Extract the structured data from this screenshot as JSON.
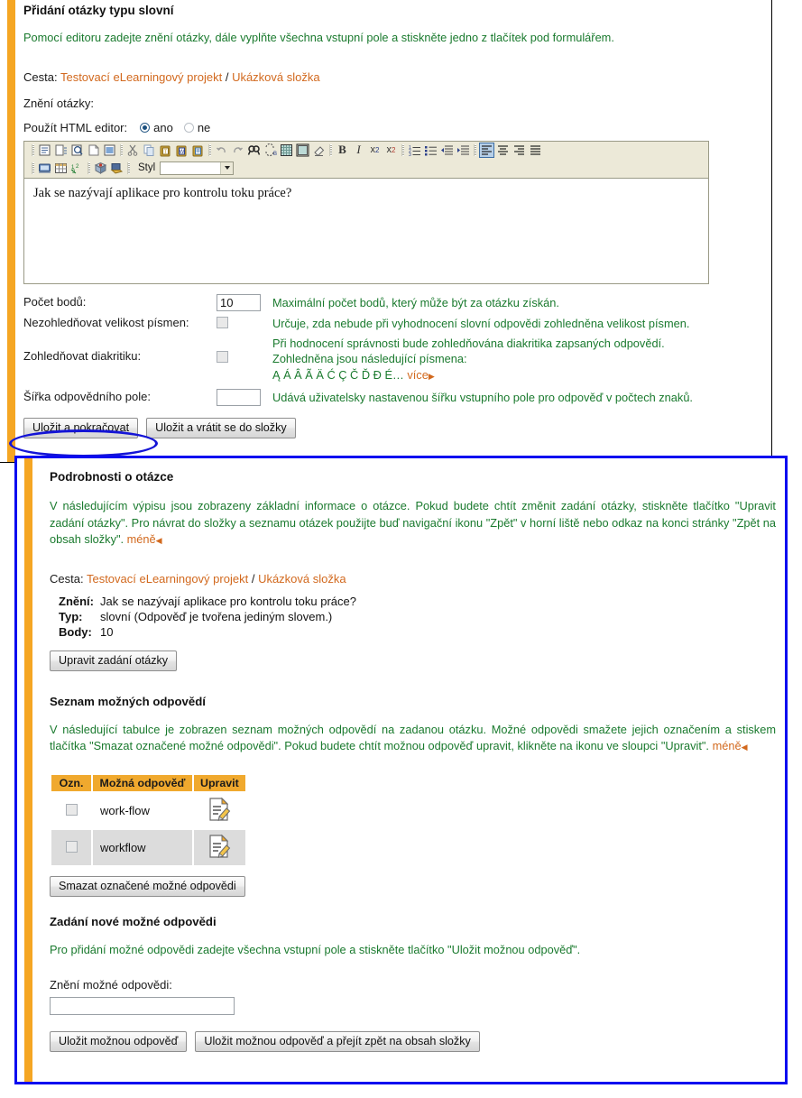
{
  "top": {
    "title": "Přidání otázky typu slovní",
    "intro": "Pomocí editoru zadejte znění otázky, dále vyplňte všechna vstupní pole a stiskněte jedno z tlačítek pod formulářem.",
    "path_label": "Cesta:",
    "path_project": "Testovací eLearningový projekt",
    "path_sep": "/",
    "path_folder": "Ukázková složka",
    "question_label": "Znění otázky:",
    "html_editor_label": "Použít HTML editor:",
    "radio_yes": "ano",
    "radio_no": "ne",
    "editor_style_label": "Styl",
    "editor_style_value": "",
    "editor_content": "Jak se nazývají aplikace pro kontrolu toku práce?",
    "fields": {
      "points_label": "Počet bodů:",
      "points_value": "10",
      "points_help": "Maximální počet bodů, který může být za otázku získán.",
      "ignore_case_label": "Nezohledňovat velikost písmen:",
      "ignore_case_help": "Určuje, zda nebude při vyhodnocení slovní odpovědi zohledněna velikost písmen.",
      "diacritics_label": "Zohledňovat diakritiku:",
      "diacritics_help_1": "Při hodnocení správnosti bude zohledňována diakritika zapsaných odpovědí.",
      "diacritics_help_2": "Zohledněna jsou následující písmena:",
      "diacritics_letters": "Ą Á Â Ã Ä Ć Ç Č Ď Đ É…",
      "diacritics_more": "více",
      "width_label": "Šířka odpovědního pole:",
      "width_value": "",
      "width_help": "Udává uživatelsky nastavenou šířku vstupního pole pro odpověď v počtech znaků."
    },
    "buttons": {
      "save_continue": "Uložit a pokračovat",
      "save_back": "Uložit a vrátit se do složky"
    }
  },
  "details": {
    "title": "Podrobnosti o otázce",
    "intro": "V následujícím výpisu jsou zobrazeny základní informace o otázce. Pokud budete chtít změnit zadání otázky, stiskněte tlačítko \"Upravit zadání otázky\". Pro návrat do složky a seznamu otázek použijte buď navigační ikonu \"Zpět\" v horní liště nebo odkaz na konci stránky \"Zpět na obsah složky\".",
    "intro_less": "méně",
    "path_label": "Cesta:",
    "path_project": "Testovací eLearningový projekt",
    "path_sep": "/",
    "path_folder": "Ukázková složka",
    "info": [
      {
        "key": "Znění:",
        "value": "Jak se nazývají aplikace pro kontrolu toku práce?"
      },
      {
        "key": "Typ:",
        "value": "slovní (Odpověď je tvořena jediným slovem.)"
      },
      {
        "key": "Body:",
        "value": "10"
      }
    ],
    "edit_question_button": "Upravit zadání otázky",
    "answers_title": "Seznam možných odpovědí",
    "answers_intro": "V následující tabulce je zobrazen seznam možných odpovědí na zadanou otázku. Možné odpovědi smažete jejich označením a stiskem tlačítka \"Smazat označené možné odpovědi\". Pokud budete chtít možnou odpověď upravit, klikněte na ikonu ve sloupci \"Upravit\".",
    "answers_intro_less": "méně",
    "table": {
      "headers": [
        "Ozn.",
        "Možná odpověď",
        "Upravit"
      ],
      "rows": [
        {
          "checked": false,
          "answer": "work-flow",
          "edit_icon": "edit-document-icon"
        },
        {
          "checked": false,
          "answer": "workflow",
          "edit_icon": "edit-document-icon"
        }
      ]
    },
    "delete_button": "Smazat označené možné odpovědi",
    "new_answer_title": "Zadání nové možné odpovědi",
    "new_answer_intro": "Pro přidání možné odpovědi zadejte všechna vstupní pole a stiskněte tlačítko \"Uložit možnou odpověď\".",
    "new_answer_label": "Znění možné odpovědi:",
    "new_answer_value": "",
    "save_answer_button": "Uložit možnou odpověď",
    "save_answer_back_button": "Uložit možnou odpověď a přejít zpět na obsah složky"
  },
  "colors": {
    "accent_orange": "#f5a623",
    "link_orange": "#d2691e",
    "help_green": "#1a7a2e",
    "highlight_blue": "#0a0af0",
    "table_header": "#f0a92e"
  }
}
